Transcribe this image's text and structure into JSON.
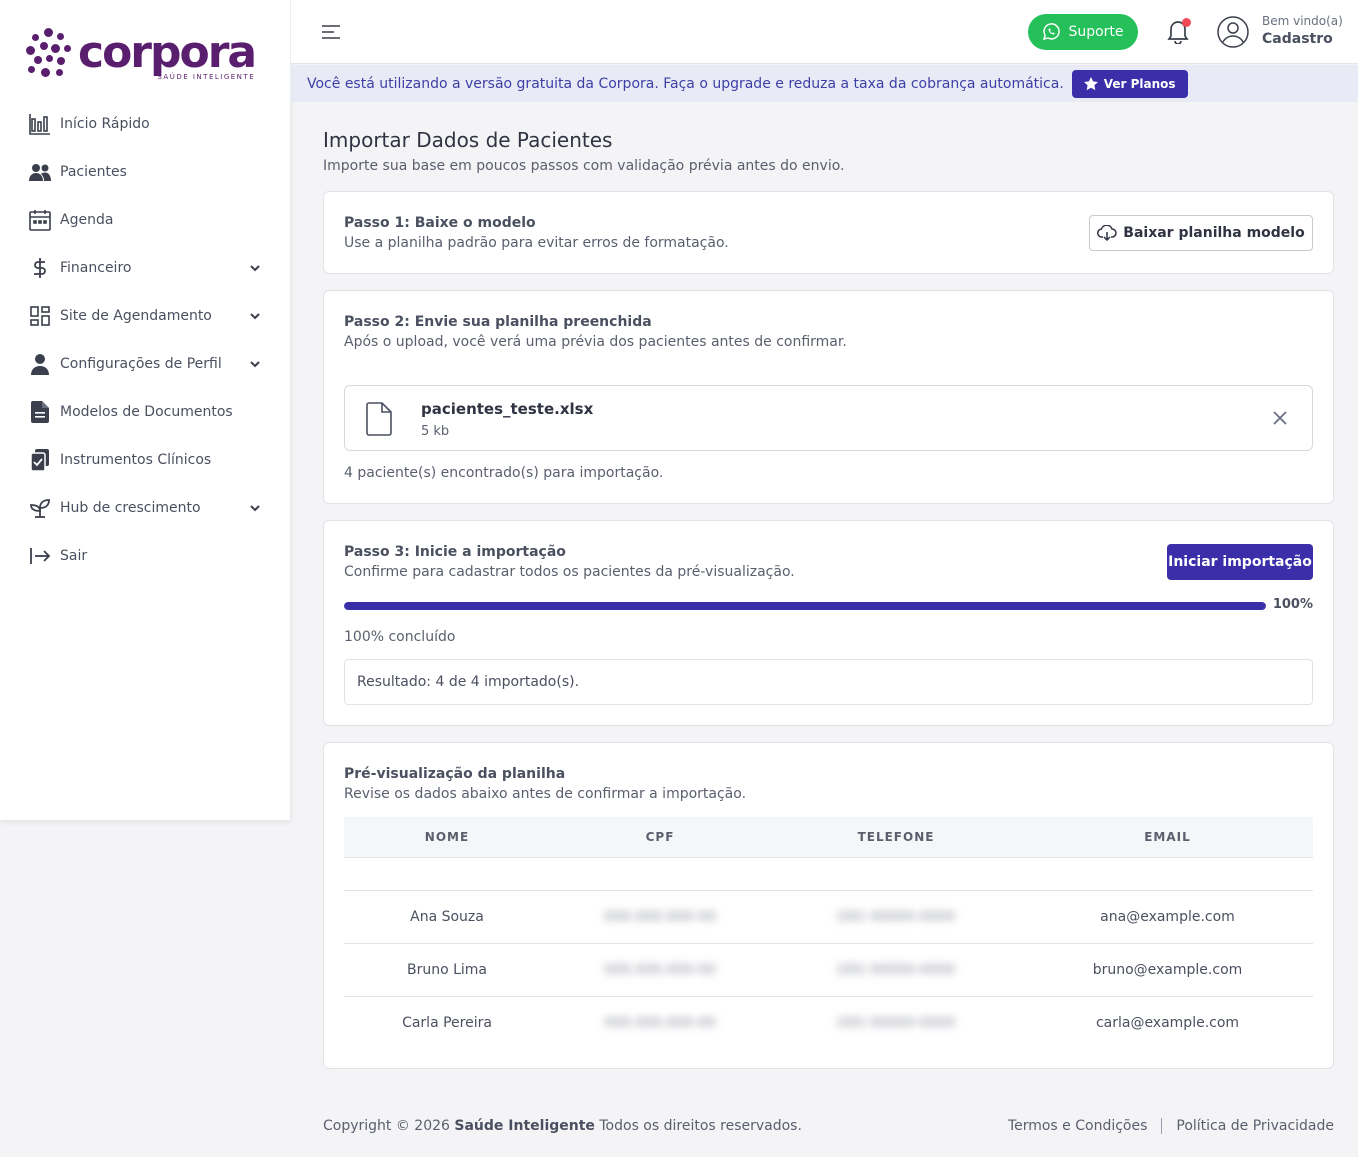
{
  "brand": {
    "name": "corpora",
    "tagline": "SAÚDE INTELIGENTE",
    "color": "#5a1e6f"
  },
  "sidebar": {
    "items": [
      {
        "label": "Início Rápido",
        "icon": "bar-chart-icon"
      },
      {
        "label": "Pacientes",
        "icon": "users-icon"
      },
      {
        "label": "Agenda",
        "icon": "calendar-icon"
      },
      {
        "label": "Financeiro",
        "icon": "dollar-icon",
        "expandable": true
      },
      {
        "label": "Site de Agendamento",
        "icon": "grid-icon",
        "expandable": true
      },
      {
        "label": "Configurações de Perfil",
        "icon": "user-icon",
        "expandable": true
      },
      {
        "label": "Modelos de Documentos",
        "icon": "document-icon"
      },
      {
        "label": "Instrumentos Clínicos",
        "icon": "clipboard-check-icon"
      },
      {
        "label": "Hub de crescimento",
        "icon": "sprout-icon",
        "expandable": true
      },
      {
        "label": "Sair",
        "icon": "logout-icon"
      }
    ]
  },
  "topbar": {
    "support_label": "Suporte",
    "welcome": "Bem vindo(a)",
    "user_name": "Cadastro"
  },
  "banner": {
    "text": "Você está utilizando a versão gratuita da Corpora. Faça o upgrade e reduza a taxa da cobrança automática.",
    "button_label": "Ver Planos"
  },
  "page": {
    "title": "Importar Dados de Pacientes",
    "subtitle": "Importe sua base em poucos passos com validação prévia antes do envio."
  },
  "step1": {
    "title": "Passo 1: Baixe o modelo",
    "desc": "Use a planilha padrão para evitar erros de formatação.",
    "button_label": "Baixar planilha modelo"
  },
  "step2": {
    "title": "Passo 2: Envie sua planilha preenchida",
    "desc": "Após o upload, você verá uma prévia dos pacientes antes de confirmar.",
    "file_name": "pacientes_teste.xlsx",
    "file_size": "5 kb",
    "found_text": "4 paciente(s) encontrado(s) para importação."
  },
  "step3": {
    "title": "Passo 3: Inicie a importação",
    "desc": "Confirme para cadastrar todos os pacientes da pré-visualização.",
    "button_label": "Iniciar importação",
    "progress": 100,
    "progress_text": "100%",
    "progress_label": "100% concluído",
    "result": "Resultado: 4 de 4 importado(s)."
  },
  "preview": {
    "title": "Pré-visualização da planilha",
    "desc": "Revise os dados abaixo antes de confirmar a importação.",
    "columns": [
      "NOME",
      "CPF",
      "TELEFONE",
      "EMAIL"
    ],
    "rows": [
      {
        "nome": "Ana Souza",
        "cpf": "000.000.000-00",
        "telefone": "(00) 00000-0000",
        "email": "ana@example.com"
      },
      {
        "nome": "Bruno Lima",
        "cpf": "000.000.000-00",
        "telefone": "(00) 00000-0000",
        "email": "bruno@example.com"
      },
      {
        "nome": "Carla Pereira",
        "cpf": "000.000.000-00",
        "telefone": "(00) 00000-0000",
        "email": "carla@example.com"
      }
    ]
  },
  "footer": {
    "copyright_prefix": "Copyright © 2026",
    "company": "Saúde Inteligente",
    "copyright_suffix": "Todos os direitos reservados.",
    "terms": "Termos e Condições",
    "privacy": "Política de Privacidade"
  },
  "colors": {
    "primary": "#3a2fa8",
    "success": "#25c05a",
    "alert": "#f24b55"
  }
}
